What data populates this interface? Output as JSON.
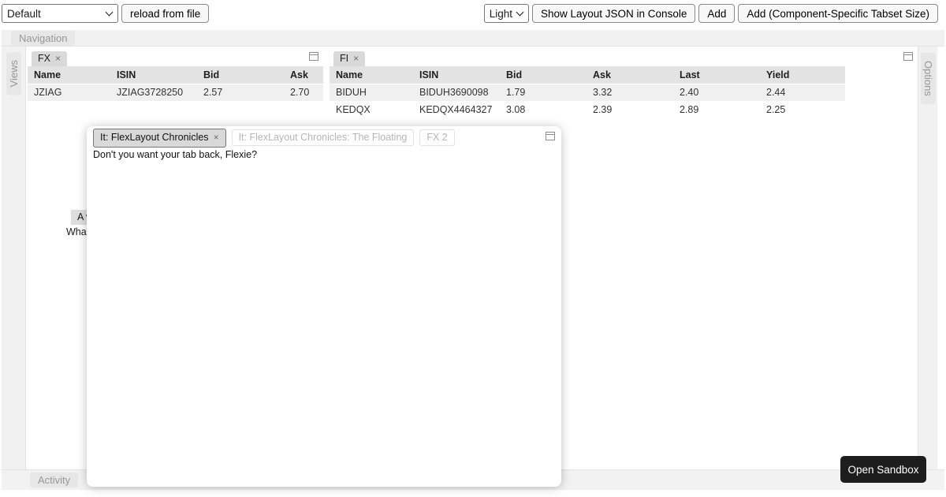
{
  "toolbar": {
    "layout_select_value": "Default",
    "reload_button_label": "reload from file",
    "theme_select_value": "Light",
    "show_json_button_label": "Show Layout JSON in Console",
    "add_button_label": "Add",
    "add_sized_button_label": "Add (Component-Specific Tabset Size)"
  },
  "border_tabs": {
    "top": "Navigation",
    "left": "Views",
    "right": "Options",
    "bottom": "Activity"
  },
  "fx_tabset": {
    "tab_label": "FX",
    "table": {
      "headers": [
        "Name",
        "ISIN",
        "Bid",
        "Ask"
      ],
      "rows": [
        [
          "JZIAG",
          "JZIAG3728250",
          "2.57",
          "2.70"
        ]
      ]
    }
  },
  "fi_tabset": {
    "tab_label": "FI",
    "table": {
      "headers": [
        "Name",
        "ISIN",
        "Bid",
        "Ask",
        "Last",
        "Yield"
      ],
      "rows": [
        [
          "BIDUH",
          "BIDUH3690098",
          "1.79",
          "3.32",
          "2.40",
          "2.44"
        ],
        [
          "KEDQX",
          "KEDQX4464327",
          "3.08",
          "2.39",
          "2.89",
          "2.25"
        ]
      ]
    }
  },
  "floating_window": {
    "tabs": [
      {
        "label": "It: FlexLayout Chronicles",
        "selected": true,
        "closable": true
      },
      {
        "label": "It: FlexLayout Chronicles: The Floating",
        "selected": false,
        "closable": false
      },
      {
        "label": "FX 2",
        "selected": false,
        "closable": false
      }
    ],
    "content": "Don't you want your tab back, Flexie?"
  },
  "obscured_panel": {
    "tab_label_visible": "A w",
    "content_visible": "Wha"
  },
  "sandbox_button_label": "Open Sandbox",
  "glyphs": {
    "close": "×"
  },
  "colors": {
    "selected_tab_bg": "#d9d9d9",
    "table_header_bg": "#e3e3e3",
    "table_row_alt_bg": "#f0f0f0",
    "border_strip_bg": "#f1f1f1",
    "border_tab_bg": "#e7e7e7",
    "unselected_tab_text": "#b5b5b5",
    "sandbox_button_bg": "#1d1d1d"
  }
}
